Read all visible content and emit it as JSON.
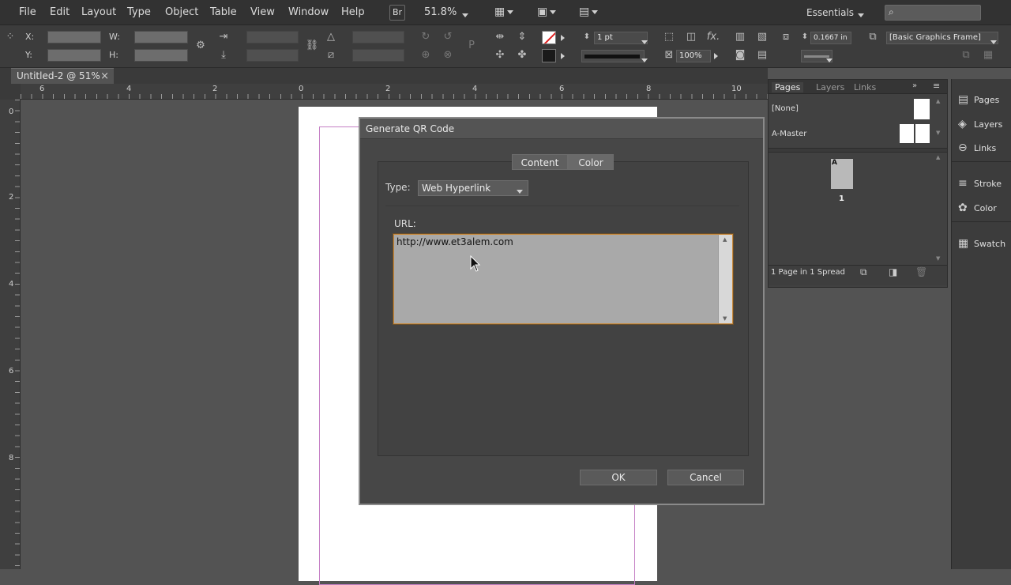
{
  "menu": {
    "items": [
      "File",
      "Edit",
      "Layout",
      "Type",
      "Object",
      "Table",
      "View",
      "Window",
      "Help"
    ],
    "bridge_label": "Br",
    "zoom": "51.8%",
    "workspace": "Essentials"
  },
  "control": {
    "x_label": "X:",
    "y_label": "Y:",
    "w_label": "W:",
    "h_label": "H:",
    "stroke_weight": "1 pt",
    "offset_value": "0.1667 in",
    "opacity": "100%",
    "object_style": "[Basic Graphics Frame]",
    "fx_label": "fx."
  },
  "document": {
    "tab_title": "Untitled-2 @ 51%",
    "close_glyph": "×"
  },
  "rulers": {
    "h_ticks": [
      "6",
      "4",
      "2",
      "0",
      "2",
      "4",
      "6",
      "8",
      "10"
    ],
    "v_ticks": [
      "0",
      "2",
      "4",
      "6",
      "8"
    ]
  },
  "pages_panel": {
    "tabs": [
      "Pages",
      "Layers",
      "Links"
    ],
    "none_label": "[None]",
    "master_label": "A-Master",
    "page_master_letter": "A",
    "page_number": "1",
    "footer_status": "1 Page in 1 Spread"
  },
  "dock": {
    "items": [
      "Pages",
      "Layers",
      "Links",
      "Stroke",
      "Color",
      "Swatch"
    ]
  },
  "dialog": {
    "title": "Generate QR Code",
    "tab_content": "Content",
    "tab_color": "Color",
    "type_label": "Type:",
    "type_value": "Web Hyperlink",
    "url_label": "URL:",
    "url_value": "http://www.et3alem.com",
    "ok_label": "OK",
    "cancel_label": "Cancel"
  },
  "colors": {
    "accent_border": "#c88a3c",
    "margin_guide": "#c580c5",
    "selected_tab": "#5f5f5f"
  }
}
